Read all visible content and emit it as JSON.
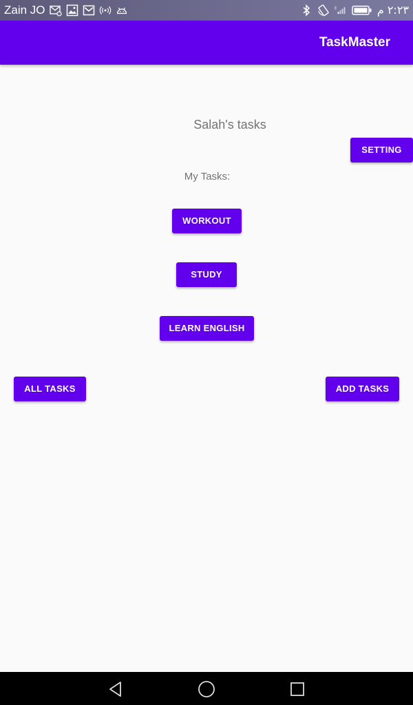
{
  "status_bar": {
    "carrier": "Zain JO",
    "time": "٢:٢٣ م",
    "icons_left": [
      "mail-settings-icon",
      "image-icon",
      "gmail-icon",
      "hotspot-icon",
      "android-icon"
    ],
    "icons_right": [
      "bluetooth-icon",
      "rotation-lock-icon",
      "signal-icon",
      "battery-icon"
    ]
  },
  "app_bar": {
    "title": "TaskMaster",
    "color": "#6200ee"
  },
  "main": {
    "heading": "Salah's tasks",
    "subheading": "My Tasks:",
    "setting_button": "SETTING",
    "tasks": [
      "WORKOUT",
      "STUDY",
      "LEARN ENGLISH"
    ],
    "all_tasks_button": "ALL TASKS",
    "add_tasks_button": "ADD TASKS"
  },
  "nav_bar": {
    "icons": [
      "back-icon",
      "home-icon",
      "recents-icon"
    ]
  },
  "colors": {
    "accent": "#6200ee",
    "background": "#fafafa",
    "text_secondary": "#737373"
  }
}
